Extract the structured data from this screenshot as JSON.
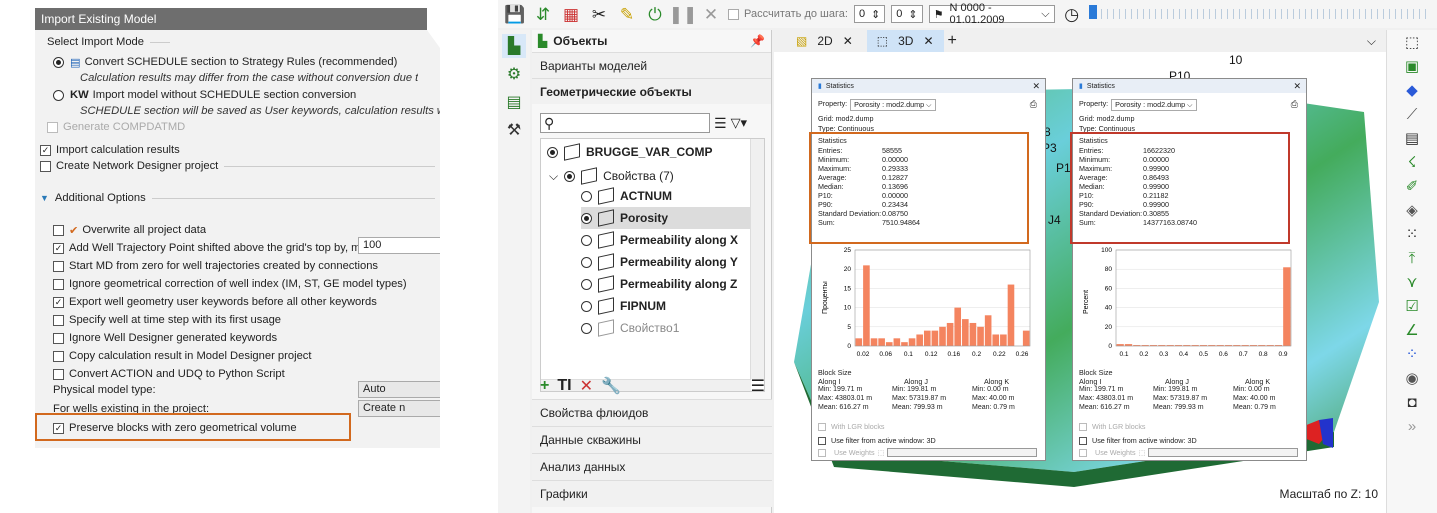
{
  "left": {
    "title": "Import Existing Model",
    "section_mode": "Select Import Mode",
    "opt1": "Convert SCHEDULE section to Strategy Rules (recommended)",
    "opt1_note": "Calculation results may differ from the case without conversion due t",
    "opt2_prefix": "KW",
    "opt2": "Import model without SCHEDULE section conversion",
    "opt2_note": "SCHEDULE section will be saved as User keywords, calculation results w",
    "compdat": "Generate COMPDATMD",
    "import_results": "Import calculation results",
    "network": "Create Network Designer project",
    "additional": "Additional Options",
    "opts": [
      {
        "label": "Overwrite all project data",
        "checked": false
      },
      {
        "label": "Add Well Trajectory Point shifted above the grid's top by, m:",
        "checked": true
      },
      {
        "label": "Start MD from zero for well trajectories created by connections",
        "checked": false
      },
      {
        "label": "Ignore geometrical correction of well index (IM, ST, GE model types)",
        "checked": false
      },
      {
        "label": "Export well geometry user keywords before all other keywords",
        "checked": true
      },
      {
        "label": "Specify well at time step with its first usage",
        "checked": false
      },
      {
        "label": "Ignore Well Designer generated keywords",
        "checked": false
      },
      {
        "label": "Copy calculation result in Model Designer project",
        "checked": false
      },
      {
        "label": "Convert ACTION and UDQ to Python Script",
        "checked": false
      }
    ],
    "shift_value": "100",
    "phys_label": "Physical model type:",
    "phys_value": "Auto",
    "wells_label": "For wells existing in the project:",
    "wells_value": "Create n",
    "preserve": "Preserve blocks with zero geometrical volume"
  },
  "toolbar": {
    "calc_label": "Рассчитать до шага:",
    "step1": "0",
    "step2": "0",
    "date": "N 0000 - 01.01.2009"
  },
  "objects": {
    "title": "Объекты",
    "variants": "Варианты моделей",
    "geom": "Геометрические объекты",
    "root": "BRUGGE_VAR_COMP",
    "props": "Свойства (7)",
    "items": [
      "ACTNUM",
      "Porosity",
      "Permeability along X",
      "Permeability along Y",
      "Permeability along Z",
      "FIPNUM"
    ],
    "prop1": "Свойство1",
    "sections": [
      "Свойства флюидов",
      "Данные скважины",
      "Анализ данных",
      "Графики"
    ]
  },
  "viewport": {
    "tab2d": "2D",
    "tab3d": "3D",
    "scale": "Масштаб по Z: 10",
    "well_labels": [
      "10",
      "P10",
      "8",
      "P3",
      "P17",
      "P",
      "J4"
    ]
  },
  "stats": [
    {
      "title": "Statistics",
      "property": "Porosity : mod2.dump",
      "grid": "Grid: mod2.dump",
      "type": "Type: Continuous",
      "header": "Statistics",
      "rows": [
        [
          "Entries:",
          "58555"
        ],
        [
          "Minimum:",
          "0.00000"
        ],
        [
          "Maximum:",
          "0.29333"
        ],
        [
          "Average:",
          "0.12827"
        ],
        [
          "Median:",
          "0.13696"
        ],
        [
          "P10:",
          "0.00000"
        ],
        [
          "P90:",
          "0.23434"
        ],
        [
          "Standard Deviation:",
          "0.08750"
        ],
        [
          "Sum:",
          "7510.94864"
        ]
      ],
      "ylabel": "Проценты",
      "yticks": [
        "25",
        "20",
        "15",
        "10",
        "5",
        "0"
      ],
      "xticks": [
        "0.02",
        "0.06",
        "0.1",
        "0.12",
        "0.16",
        "0.2",
        "0.22",
        "0.26"
      ],
      "bars": [
        2,
        21,
        2,
        2,
        1,
        2,
        1,
        2,
        3,
        4,
        4,
        5,
        6,
        10,
        7,
        6,
        5,
        8,
        3,
        3,
        16,
        0,
        4
      ],
      "block": "Block Size",
      "alongI": "Along I",
      "alongJ": "Along J",
      "alongK": "Along K",
      "bi": [
        "Min:  199.71 m",
        "Max:  43803.01 m",
        "Mean: 616.27 m"
      ],
      "bj": [
        "Min:  199.81 m",
        "Max:  57319.87 m",
        "Mean: 799.93 m"
      ],
      "bk": [
        "Min:  0.00 m",
        "Max:  40.00 m",
        "Mean: 0.79 m"
      ],
      "lgr": "With LGR blocks",
      "filter": "Use filter from active window:  3D",
      "weights": "Use Weights"
    },
    {
      "title": "Statistics",
      "property": "Porosity : mod2.dump",
      "grid": "Grid: mod2.dump",
      "type": "Type: Continuous",
      "header": "Statistics",
      "rows": [
        [
          "Entries:",
          "16622320"
        ],
        [
          "Minimum:",
          "0.00000"
        ],
        [
          "Maximum:",
          "0.99900"
        ],
        [
          "Average:",
          "0.86493"
        ],
        [
          "Median:",
          "0.99900"
        ],
        [
          "P10:",
          "0.21182"
        ],
        [
          "P90:",
          "0.99900"
        ],
        [
          "Standard Deviation:",
          "0.30855"
        ],
        [
          "Sum:",
          "14377163.08740"
        ]
      ],
      "ylabel": "Percent",
      "yticks": [
        "100",
        "80",
        "60",
        "40",
        "20",
        "0"
      ],
      "xticks": [
        "0.1",
        "0.2",
        "0.3",
        "0.4",
        "0.5",
        "0.6",
        "0.7",
        "0.8",
        "0.9"
      ],
      "bars": [
        2,
        2,
        1,
        1,
        1,
        1,
        1,
        1,
        1,
        1,
        1,
        1,
        1,
        1,
        1,
        1,
        1,
        1,
        1,
        1,
        82
      ],
      "block": "Block Size",
      "alongI": "Along I",
      "alongJ": "Along J",
      "alongK": "Along K",
      "bi": [
        "Min:  199.71 m",
        "Max:  43803.01 m",
        "Mean: 616.27 m"
      ],
      "bj": [
        "Min:  199.81 m",
        "Max:  57319.87 m",
        "Mean: 799.93 m"
      ],
      "bk": [
        "Min:  0.00 m",
        "Max:  40.00 m",
        "Mean: 0.79 m"
      ],
      "lgr": "With LGR blocks",
      "filter": "Use filter from active window:  3D",
      "weights": "Use Weights"
    }
  ],
  "colors": {
    "accent_orange": "#d2691e",
    "highlight_red": "#c0392b",
    "bar": "#f4845f",
    "tab_active": "#cfe3f7"
  }
}
